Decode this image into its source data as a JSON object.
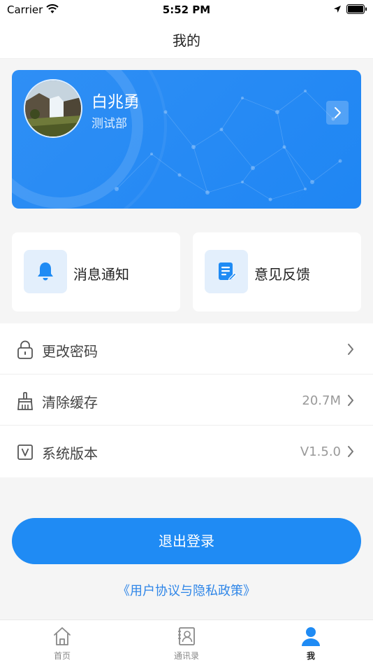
{
  "status_bar": {
    "carrier": "Carrier",
    "time": "5:52 PM"
  },
  "nav": {
    "title": "我的"
  },
  "profile": {
    "name": "白兆勇",
    "department": "测试部"
  },
  "tiles": [
    {
      "label": "消息通知",
      "icon": "bell-icon"
    },
    {
      "label": "意见反馈",
      "icon": "feedback-icon"
    }
  ],
  "settings": [
    {
      "label": "更改密码",
      "value": "",
      "icon": "lock-icon"
    },
    {
      "label": "清除缓存",
      "value": "20.7M",
      "icon": "broom-icon"
    },
    {
      "label": "系统版本",
      "value": "V1.5.0",
      "icon": "version-icon"
    }
  ],
  "logout": {
    "label": "退出登录"
  },
  "policy": {
    "label": "《用户协议与隐私政策》"
  },
  "tab_bar": {
    "tabs": [
      {
        "label": "首页",
        "icon": "home-icon",
        "active": false
      },
      {
        "label": "通讯录",
        "icon": "contacts-icon",
        "active": false
      },
      {
        "label": "我",
        "icon": "person-icon",
        "active": true
      }
    ]
  },
  "colors": {
    "primary": "#1f8bf4",
    "tile_icon_bg": "#e3effc",
    "page_bg": "#f5f5f5"
  }
}
